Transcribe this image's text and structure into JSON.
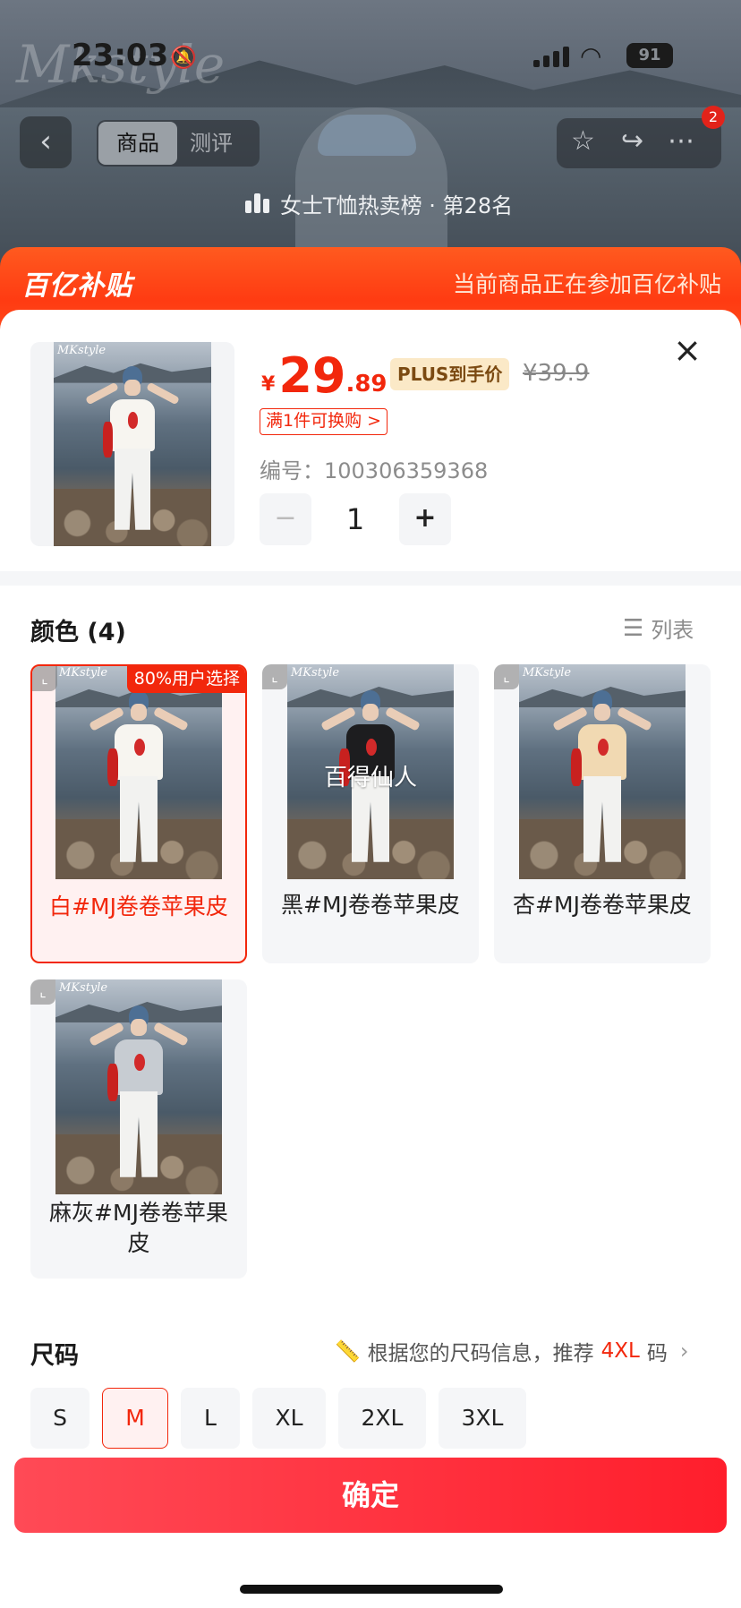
{
  "status_bar": {
    "time": "23:03",
    "battery": "91"
  },
  "topbar": {
    "tabs": [
      {
        "label": "商品"
      },
      {
        "label": "测评"
      }
    ],
    "cart_badge": "2"
  },
  "rank": {
    "text": "女士T恤热卖榜 · 第28名"
  },
  "banner": {
    "logo": "百亿补贴",
    "message": "当前商品正在参加百亿补贴"
  },
  "product": {
    "currency": "¥",
    "price_int": "29",
    "price_dec": ".89",
    "plus_tag": "PLUS到手价",
    "original_price": "¥39.9",
    "coupon": "满1件可换购 >",
    "sku_label": "编号：100306359368",
    "quantity": "1",
    "minus": "−",
    "plus": "+"
  },
  "color_section": {
    "title": "颜色 (4)",
    "toggle_label": "列表",
    "options": [
      {
        "label": "白#MJ卷卷苹果皮",
        "tag": "80%用户选择",
        "selected": true,
        "shirt": "#f7f5f0"
      },
      {
        "label": "黑#MJ卷卷苹果皮",
        "overlay": "百得仙人",
        "selected": false,
        "shirt": "#1d1d1f"
      },
      {
        "label": "杏#MJ卷卷苹果皮",
        "selected": false,
        "shirt": "#f1d9b2"
      },
      {
        "label": "麻灰#MJ卷卷苹果皮",
        "selected": false,
        "shirt": "#c7ccd2"
      }
    ]
  },
  "size_section": {
    "title": "尺码",
    "hint_prefix": "根据您的尺码信息，推荐",
    "hint_value": "4XL",
    "hint_suffix": "码",
    "options": [
      {
        "label": "S",
        "selected": false
      },
      {
        "label": "M",
        "selected": true
      },
      {
        "label": "L",
        "selected": false
      },
      {
        "label": "XL",
        "selected": false
      },
      {
        "label": "2XL",
        "selected": false
      },
      {
        "label": "3XL",
        "selected": false
      }
    ]
  },
  "confirm_button": "确定",
  "thumb_logo": "MKstyle",
  "colors": {
    "accent": "#f2270c",
    "banner": "#ff3b12",
    "plus_bg": "#fbe9c7"
  }
}
